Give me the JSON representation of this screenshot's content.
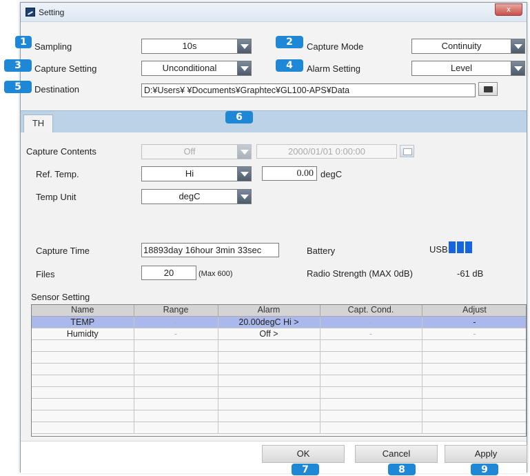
{
  "window": {
    "title": "Setting",
    "close_glyph": "x"
  },
  "settings": {
    "sampling": {
      "label": "Sampling",
      "value": "10s"
    },
    "capture_mode": {
      "label": "Capture Mode",
      "value": "Continuity"
    },
    "capture_setting": {
      "label": "Capture Setting",
      "value": "Unconditional"
    },
    "alarm_setting": {
      "label": "Alarm Setting",
      "value": "Level"
    },
    "destination": {
      "label": "Destination",
      "value": "D:¥Users¥        ¥Documents¥Graphtec¥GL100-APS¥Data"
    }
  },
  "tabs": [
    {
      "label": "TH"
    }
  ],
  "th": {
    "capture_contents": {
      "label": "Capture Contents",
      "value": "Off",
      "datetime": "2000/01/01 0:00:00"
    },
    "ref_temp": {
      "label": "Ref. Temp.",
      "value": "Hi",
      "threshold": "0.00",
      "unit": "degC"
    },
    "temp_unit": {
      "label": "Temp Unit",
      "value": "degC"
    },
    "capture_time": {
      "label": "Capture Time",
      "value": "18893day 16hour 3min 33sec"
    },
    "files": {
      "label": "Files",
      "value": "20",
      "max": "(Max 600)"
    },
    "battery": {
      "label": "Battery",
      "source": "USB",
      "bars": 3
    },
    "radio": {
      "label": "Radio Strength (MAX 0dB)",
      "value": "-61 dB"
    }
  },
  "sensor": {
    "title": "Sensor Setting",
    "columns": [
      "Name",
      "Range",
      "Alarm",
      "Capt. Cond.",
      "Adjust"
    ],
    "rows": [
      [
        "TEMP",
        "-",
        "20.00degC Hi >",
        "-",
        "-"
      ],
      [
        "Humidty",
        "-",
        "Off >",
        "-",
        "-"
      ]
    ]
  },
  "buttons": {
    "ok": "OK",
    "cancel": "Cancel",
    "apply": "Apply"
  },
  "badges": [
    "1",
    "2",
    "3",
    "4",
    "5",
    "6",
    "7",
    "8",
    "9"
  ],
  "colors": {
    "badge": "#1e88d6",
    "selected_row": "#aab8ec",
    "tab_strip": "#bcd2e6",
    "battery": "#1565e0"
  }
}
